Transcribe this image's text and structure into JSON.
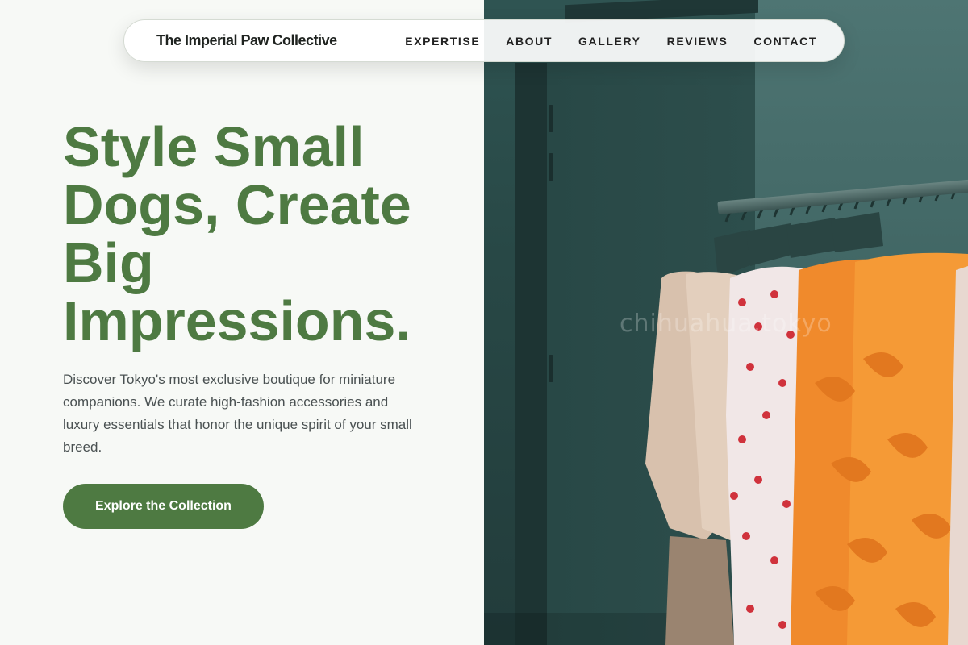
{
  "nav": {
    "brand": "The Imperial Paw Collective",
    "links": [
      "EXPERTISE",
      "ABOUT",
      "GALLERY",
      "REVIEWS",
      "CONTACT"
    ]
  },
  "hero": {
    "title": "Style Small Dogs, Create Big Impressions.",
    "description": "Discover Tokyo's most exclusive boutique for miniature companions. We curate high-fashion accessories and luxury essentials that honor the unique spirit of your small breed.",
    "cta_label": "Explore the Collection"
  },
  "image": {
    "watermark": "chihuahua.tokyo"
  },
  "colors": {
    "accent": "#4e7a42",
    "background": "#f7f9f6",
    "text": "#4a5152"
  }
}
